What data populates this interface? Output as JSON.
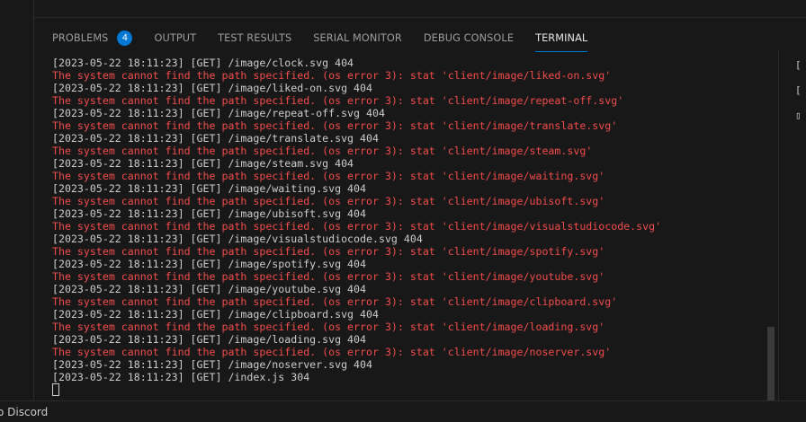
{
  "panel": {
    "tabs": [
      {
        "label": "PROBLEMS",
        "badge": "4"
      },
      {
        "label": "OUTPUT"
      },
      {
        "label": "TEST RESULTS"
      },
      {
        "label": "SERIAL MONITOR"
      },
      {
        "label": "DEBUG CONSOLE"
      },
      {
        "label": "TERMINAL"
      }
    ]
  },
  "terminal": {
    "lines": [
      {
        "text": "[2023-05-22 18:11:23] [GET] /image/clock.svg 404",
        "type": "info"
      },
      {
        "text": "The system cannot find the path specified. (os error 3): stat 'client/image/liked-on.svg'",
        "type": "err"
      },
      {
        "text": "[2023-05-22 18:11:23] [GET] /image/liked-on.svg 404",
        "type": "info"
      },
      {
        "text": "The system cannot find the path specified. (os error 3): stat 'client/image/repeat-off.svg'",
        "type": "err"
      },
      {
        "text": "[2023-05-22 18:11:23] [GET] /image/repeat-off.svg 404",
        "type": "info"
      },
      {
        "text": "The system cannot find the path specified. (os error 3): stat 'client/image/translate.svg'",
        "type": "err"
      },
      {
        "text": "[2023-05-22 18:11:23] [GET] /image/translate.svg 404",
        "type": "info"
      },
      {
        "text": "The system cannot find the path specified. (os error 3): stat 'client/image/steam.svg'",
        "type": "err"
      },
      {
        "text": "[2023-05-22 18:11:23] [GET] /image/steam.svg 404",
        "type": "info"
      },
      {
        "text": "The system cannot find the path specified. (os error 3): stat 'client/image/waiting.svg'",
        "type": "err"
      },
      {
        "text": "[2023-05-22 18:11:23] [GET] /image/waiting.svg 404",
        "type": "info"
      },
      {
        "text": "The system cannot find the path specified. (os error 3): stat 'client/image/ubisoft.svg'",
        "type": "err"
      },
      {
        "text": "[2023-05-22 18:11:23] [GET] /image/ubisoft.svg 404",
        "type": "info"
      },
      {
        "text": "The system cannot find the path specified. (os error 3): stat 'client/image/visualstudiocode.svg'",
        "type": "err"
      },
      {
        "text": "[2023-05-22 18:11:23] [GET] /image/visualstudiocode.svg 404",
        "type": "info"
      },
      {
        "text": "The system cannot find the path specified. (os error 3): stat 'client/image/spotify.svg'",
        "type": "err"
      },
      {
        "text": "[2023-05-22 18:11:23] [GET] /image/spotify.svg 404",
        "type": "info"
      },
      {
        "text": "The system cannot find the path specified. (os error 3): stat 'client/image/youtube.svg'",
        "type": "err"
      },
      {
        "text": "[2023-05-22 18:11:23] [GET] /image/youtube.svg 404",
        "type": "info"
      },
      {
        "text": "The system cannot find the path specified. (os error 3): stat 'client/image/clipboard.svg'",
        "type": "err"
      },
      {
        "text": "[2023-05-22 18:11:23] [GET] /image/clipboard.svg 404",
        "type": "info"
      },
      {
        "text": "The system cannot find the path specified. (os error 3): stat 'client/image/loading.svg'",
        "type": "err"
      },
      {
        "text": "[2023-05-22 18:11:23] [GET] /image/loading.svg 404",
        "type": "info"
      },
      {
        "text": "The system cannot find the path specified. (os error 3): stat 'client/image/noserver.svg'",
        "type": "err"
      },
      {
        "text": "[2023-05-22 18:11:23] [GET] /image/noserver.svg 404",
        "type": "info"
      },
      {
        "text": "[2023-05-22 18:11:23] [GET] /index.js 304",
        "type": "info"
      }
    ]
  },
  "terminal_tabs": [
    "[",
    "[",
    "▯"
  ],
  "status": {
    "text": "o Discord"
  },
  "colors": {
    "accent": "#0078d4",
    "error": "#f14c4c",
    "text": "#cccccc",
    "background": "#181818"
  }
}
